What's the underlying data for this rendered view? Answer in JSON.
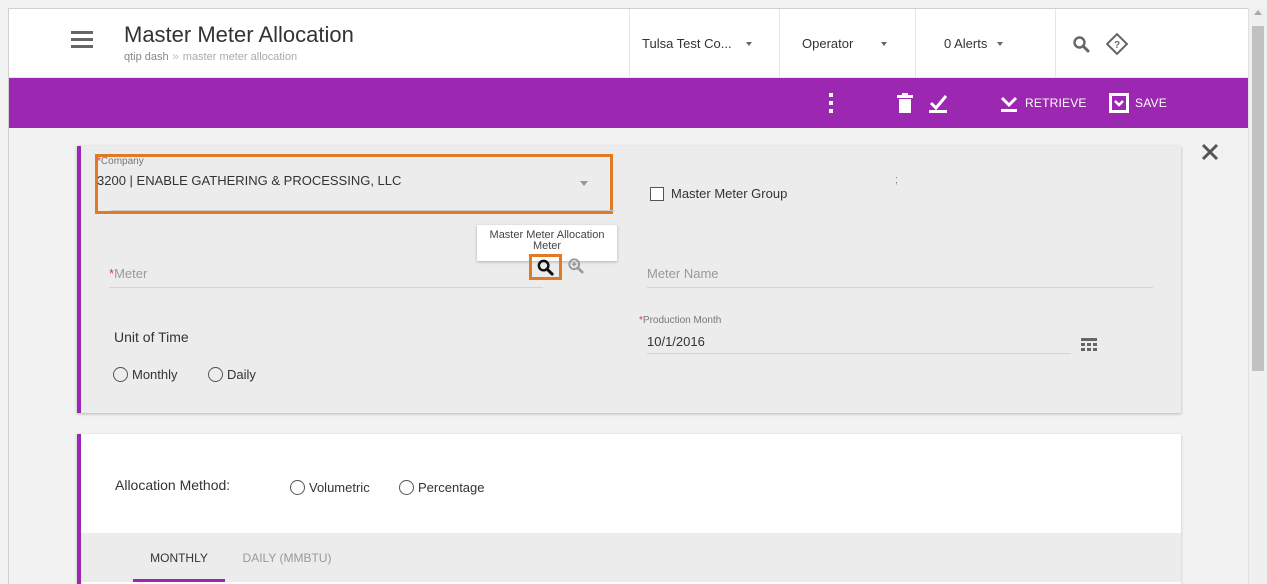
{
  "header": {
    "title": "Master Meter Allocation",
    "breadcrumb": {
      "root": "qtip dash",
      "separator": "»",
      "current": "master meter allocation"
    },
    "company_selector": "Tulsa Test Co...",
    "role_selector": "Operator",
    "alerts": "0 Alerts",
    "icons": [
      "menu-icon",
      "search-icon",
      "help-diamond-icon"
    ]
  },
  "toolbar": {
    "retrieve_label": "RETRIEVE",
    "save_label": "SAVE",
    "icons": [
      "kebab-icon",
      "delete-icon",
      "check-square-icon",
      "retrieve-icon",
      "save-icon"
    ]
  },
  "form": {
    "company": {
      "label": "Company",
      "value": "3200 | ENABLE GATHERING & PROCESSING, LLC"
    },
    "master_meter_group": {
      "label": "Master Meter Group",
      "checked": false
    },
    "semicolon": ";",
    "tooltip": "Master Meter Allocation Meter",
    "meter": {
      "label": "Meter",
      "value": ""
    },
    "meter_name": {
      "label": "Meter Name",
      "value": ""
    },
    "unit_of_time": {
      "label": "Unit of Time",
      "options": [
        "Monthly",
        "Daily"
      ]
    },
    "production_month": {
      "label": "Production Month",
      "value": "10/1/2016"
    }
  },
  "allocation": {
    "label": "Allocation Method:",
    "options": [
      "Volumetric",
      "Percentage"
    ],
    "tabs": [
      {
        "label": "MONTHLY",
        "active": true
      },
      {
        "label": "DAILY (MMBTU)",
        "active": false
      }
    ]
  },
  "colors": {
    "accent": "#9c27b0",
    "highlight": "#e07b23",
    "required": "#e53935"
  }
}
